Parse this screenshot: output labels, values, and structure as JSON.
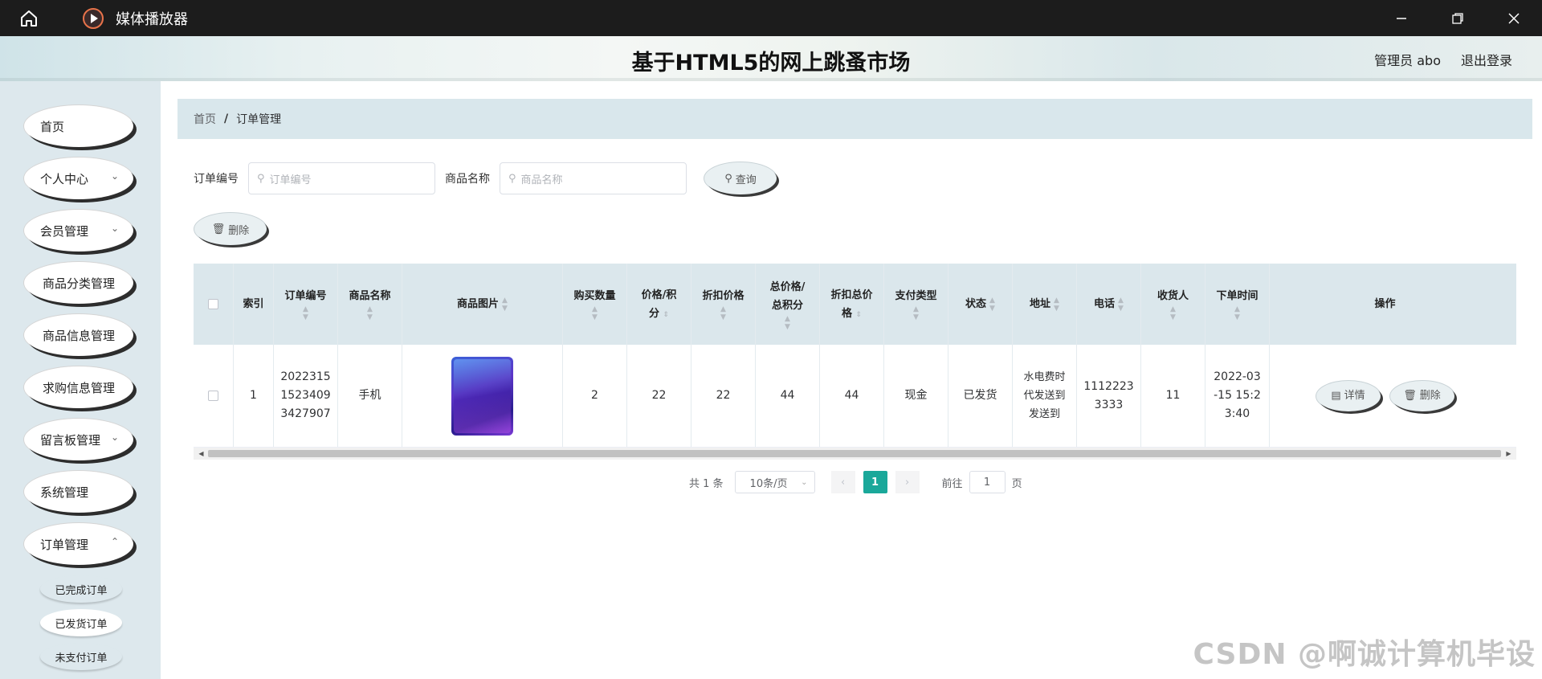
{
  "window": {
    "title": "媒体播放器"
  },
  "header": {
    "site_title": "基于HTML5的网上跳蚤市场",
    "admin_user": "管理员 abo",
    "logout": "退出登录"
  },
  "sidebar": {
    "items": [
      {
        "label": "首页"
      },
      {
        "label": "个人中心"
      },
      {
        "label": "会员管理"
      },
      {
        "label": "商品分类管理"
      },
      {
        "label": "商品信息管理"
      },
      {
        "label": "求购信息管理"
      },
      {
        "label": "留言板管理"
      },
      {
        "label": "系统管理"
      },
      {
        "label": "订单管理"
      }
    ],
    "subitems": [
      {
        "label": "已完成订单"
      },
      {
        "label": "已发货订单"
      },
      {
        "label": "未支付订单"
      }
    ]
  },
  "breadcrumb": {
    "home": "首页",
    "separator": "/",
    "current": "订单管理"
  },
  "search": {
    "order_no_label": "订单编号",
    "order_no_placeholder": "订单编号",
    "product_name_label": "商品名称",
    "product_name_placeholder": "商品名称",
    "query_button": "查询"
  },
  "actions": {
    "delete_button": "删除"
  },
  "table": {
    "headers": {
      "index": "索引",
      "order_no": "订单编号",
      "product_name": "商品名称",
      "product_image": "商品图片",
      "quantity": "购买数量",
      "price_l1": "价格/积",
      "price_l2": "分",
      "discount_price": "折扣价格",
      "total_l1": "总价格/",
      "total_l2": "总积分",
      "discount_total_l1": "折扣总价",
      "discount_total_l2": "格",
      "pay_type": "支付类型",
      "status": "状态",
      "address": "地址",
      "phone": "电话",
      "receiver": "收货人",
      "order_time": "下单时间",
      "operation": "操作"
    },
    "rows": [
      {
        "index": "1",
        "order_no": [
          "2022315",
          "1523409",
          "3427907"
        ],
        "product_name": "手机",
        "quantity": "2",
        "price": "22",
        "discount_price": "22",
        "total": "44",
        "discount_total": "44",
        "pay_type": "现金",
        "status": "已发货",
        "address": [
          "水电费时",
          "代发送到",
          "发送到"
        ],
        "phone": [
          "1112223",
          "3333"
        ],
        "receiver": "11",
        "order_time": [
          "2022-03",
          "-15 15:2",
          "3:40"
        ],
        "detail_button": "详情",
        "delete_button": "删除"
      }
    ]
  },
  "pagination": {
    "total": "共 1 条",
    "page_size": "10条/页",
    "current_page": "1",
    "goto_prefix": "前往",
    "goto_value": "1",
    "goto_suffix": "页"
  },
  "watermark": "CSDN @啊诚计算机毕设"
}
